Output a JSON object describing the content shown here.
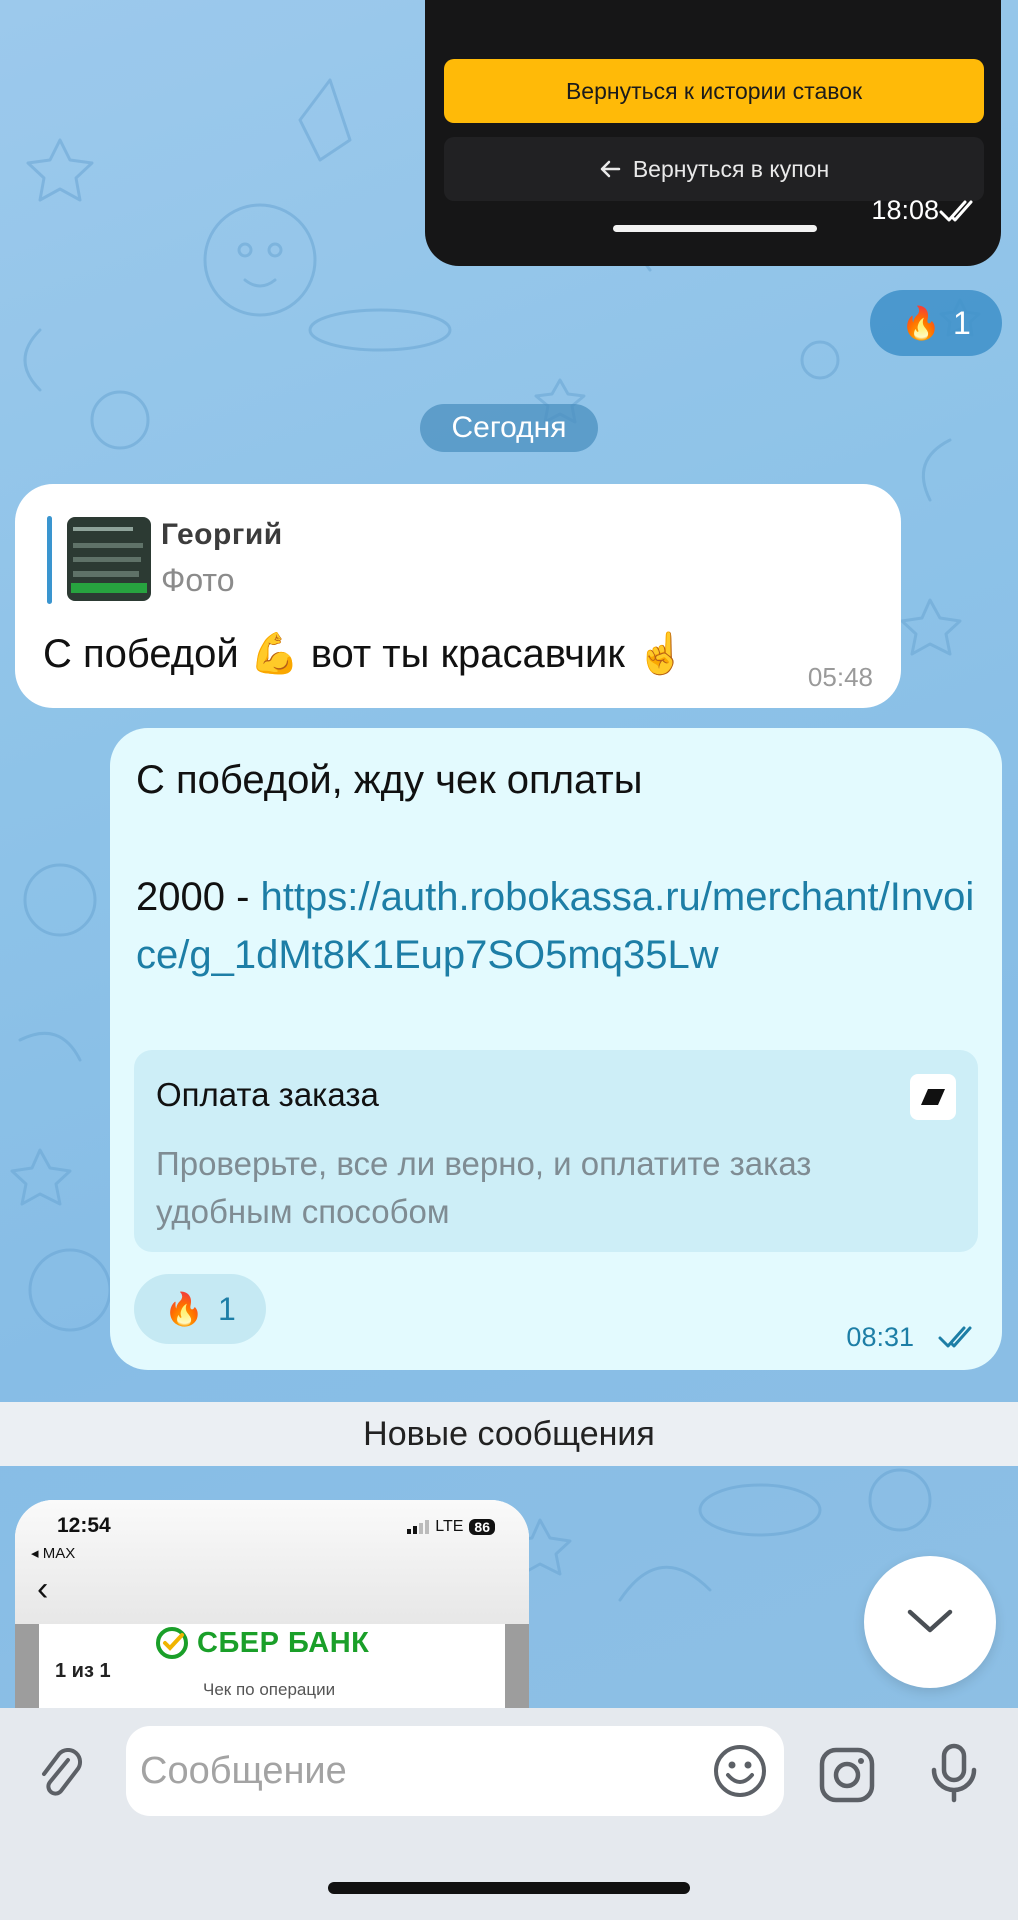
{
  "top_screenshot": {
    "primary_button": "Вернуться к истории ставок",
    "secondary_button": "Вернуться в купон",
    "secondary_icon": "arrow-left-icon",
    "time": "18:08",
    "status_icon": "double-check-icon"
  },
  "top_reaction": {
    "emoji": "🔥",
    "count": "1"
  },
  "date_separator": "Сегодня",
  "incoming_message": {
    "reply_to": {
      "name": "Георгий",
      "type": "Фото"
    },
    "text": "С победой 💪 вот ты красавчик  ☝️",
    "time": "05:48"
  },
  "outgoing_message": {
    "line1": "С победой, жду чек оплаты",
    "amount_prefix": "2000 - ",
    "link": "https://auth.robokassa.ru/merchant/Invoice/g_1dMt8K1Eup7SO5mq35Lw",
    "preview": {
      "title": "Оплата заказа",
      "description": "Проверьте, все ли верно, и оплатите заказ удобным способом"
    },
    "reaction": {
      "emoji": "🔥",
      "count": "1"
    },
    "time": "08:31",
    "status_icon": "double-check-icon"
  },
  "new_messages_label": "Новые сообщения",
  "bottom_screenshot": {
    "clock": "12:54",
    "back_app": "◂ MAX",
    "network": "LTE",
    "battery": "86",
    "page": "1 из 1",
    "bank_name": "СБЕР БАНК",
    "receipt_label": "Чек по операции"
  },
  "composer": {
    "placeholder": "Сообщение"
  },
  "colors": {
    "accent": "#1d7ea6",
    "outgoing_bubble": "#e3fafe",
    "yellow_button": "#ffba08",
    "sber_green": "#1a9f29"
  }
}
